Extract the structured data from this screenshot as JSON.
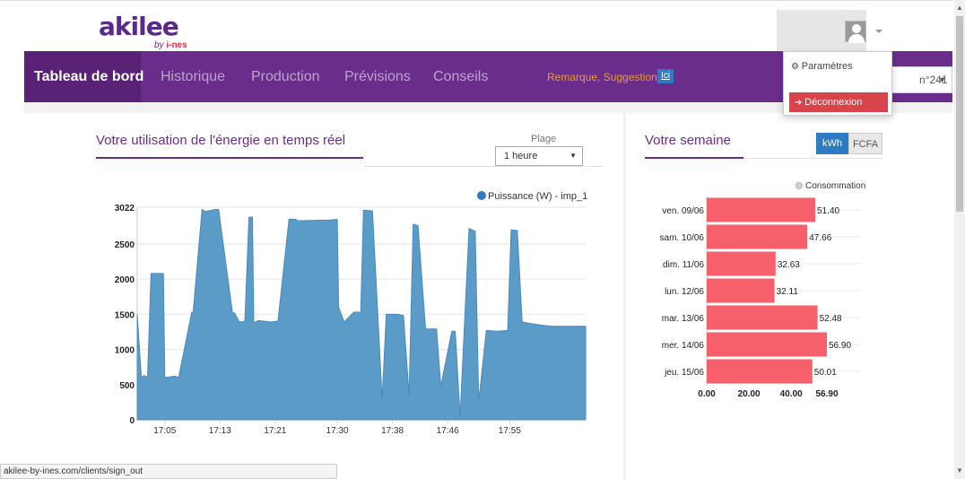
{
  "header": {
    "logo_text": "akilee",
    "logo_sub_by": "by",
    "logo_sub_brand": "i-nes"
  },
  "user_menu": {
    "items": [
      {
        "label": "Paramètres",
        "icon": "gears-icon"
      },
      {
        "label": "Déconnexion",
        "icon": "sign-out-icon"
      }
    ]
  },
  "nav": {
    "items": [
      "Tableau de bord",
      "Historique",
      "Production",
      "Prévisions",
      "Conseils"
    ],
    "active_index": 0,
    "remark": "Remarque, Suggestion?",
    "remark_link": "Ici",
    "right_select_value": "n°241"
  },
  "realtime": {
    "title": "Votre utilisation de l'énergie en temps réel",
    "range_label": "Plage",
    "range_value": "1 heure"
  },
  "week": {
    "title": "Votre semaine",
    "unit_options": [
      "kWh",
      "FCFA"
    ],
    "unit_selected": "kWh"
  },
  "status_url": "akilee-by-ines.com/clients/sign_out",
  "chart_data": [
    {
      "type": "area",
      "series": [
        {
          "name": "Puissance (W) - imp_1",
          "color": "#5b9bc8"
        }
      ],
      "legend": "top-right",
      "ylim": [
        0,
        3022
      ],
      "y_ticks": [
        "0",
        "500",
        "1000",
        "1500",
        "2000",
        "2500",
        "3022"
      ],
      "x_tick_labels": [
        "17:05",
        "17:13",
        "17:21",
        "17:30",
        "17:38",
        "17:46",
        "17:55"
      ],
      "x_tick_minutes": [
        5,
        13,
        21,
        30,
        38,
        46,
        55
      ],
      "x_minutes": [
        1,
        1.6,
        2,
        2.5,
        3,
        4.8,
        5,
        6.5,
        7,
        8.9,
        9.1,
        10.4,
        10.9,
        12.3,
        12.8,
        14.8,
        15.1,
        15.8,
        16.6,
        17.2,
        17.7,
        17.9,
        18.6,
        20.5,
        21,
        21.4,
        23,
        24,
        24.2,
        29,
        30,
        30.2,
        31,
        32.4,
        33.4,
        33.8,
        35.1,
        36.5,
        37.1,
        38.8,
        39.6,
        40.4,
        41,
        41.7,
        42.8,
        44.4,
        45,
        46.6,
        47.1,
        47.8,
        49.1,
        50,
        50.5,
        51.6,
        53.2,
        54.7,
        55.2,
        56.1,
        56.8,
        58,
        60,
        61.2,
        62.8,
        66
      ],
      "y_values": [
        1500,
        600,
        630,
        600,
        2080,
        2080,
        600,
        620,
        600,
        1530,
        1520,
        2990,
        2960,
        2990,
        2990,
        1520,
        1520,
        1390,
        1400,
        2880,
        2880,
        1380,
        1410,
        1390,
        1400,
        1400,
        2850,
        2850,
        2830,
        2840,
        2850,
        1600,
        1390,
        1530,
        1530,
        2980,
        2970,
        300,
        1500,
        1500,
        1480,
        350,
        2780,
        2760,
        1290,
        1290,
        480,
        1260,
        1260,
        50,
        2720,
        2680,
        260,
        1270,
        1260,
        1270,
        2700,
        2690,
        1390,
        1370,
        1340,
        1330,
        1330,
        1330
      ]
    },
    {
      "type": "bar",
      "orientation": "horizontal",
      "categories": [
        "ven. 09/06",
        "sam. 10/06",
        "dim. 11/06",
        "lun. 12/06",
        "mar. 13/06",
        "mer. 14/06",
        "jeu. 15/06"
      ],
      "values": [
        51.4,
        47.66,
        32.63,
        32.11,
        52.48,
        56.9,
        50.01
      ],
      "value_labels": [
        "51.40",
        "47.66",
        "32.63",
        "32.11",
        "52.48",
        "56.90",
        "50.01"
      ],
      "series": [
        {
          "name": "Consommation",
          "color": "#f5606a"
        }
      ],
      "legend_marker_color": "#cccccc",
      "x_ticks": [
        "0.00",
        "20.00",
        "40.00",
        "56.90"
      ],
      "xlim": [
        0,
        56.9
      ]
    }
  ]
}
